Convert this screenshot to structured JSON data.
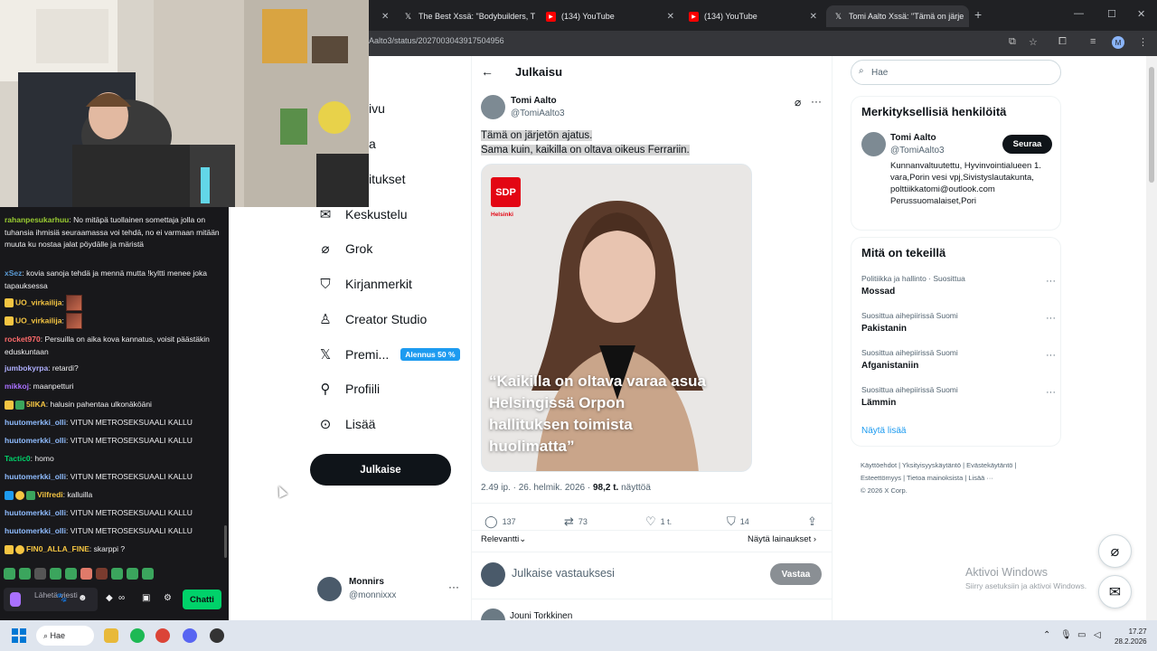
{
  "browser": {
    "tabs": [
      {
        "label": "",
        "favicon": "tab-blank"
      },
      {
        "label": "The Best Xssä: \"Bodybuilders, T",
        "favicon": "x-icon"
      },
      {
        "label": "(134) YouTube",
        "favicon": "youtube-icon"
      },
      {
        "label": "(134) YouTube",
        "favicon": "youtube-icon"
      },
      {
        "label": "Tomi Aalto Xssä: \"Tämä on järje",
        "favicon": "x-icon"
      }
    ],
    "url": "Aalto3/status/2027003043917504956",
    "profile_initial": "M"
  },
  "chat": {
    "messages": [
      {
        "user": "rahanpesukarhuu",
        "color": "#9acd32",
        "text": "No mitäpä tuollainen somettaja jolla on tuhansia ihmisiä seuraamassa voi tehdä, no ei varmaan mitään muuta ku nostaa jalat pöydälle ja märistä"
      },
      {
        "user": "xSez",
        "color": "#5b9bd5",
        "text": "kovia sanoja tehdä ja mennä mutta !kyltti menee joka tapauksessa"
      },
      {
        "user": "UO_virkailija",
        "color": "#f5c542",
        "text": ""
      },
      {
        "user": "UO_virkailija",
        "color": "#f5c542",
        "text": ""
      },
      {
        "user": "rocket970",
        "color": "#ff6b6b",
        "text": "Persuilla on aika kova kannatus, voisit päästäkin eduskuntaan"
      },
      {
        "user": "jumbokyrpa",
        "color": "#b0b0ff",
        "text": "retardi?"
      },
      {
        "user": "mikkoj",
        "color": "#a970ff",
        "text": "maanpetturi"
      },
      {
        "user": "5IIKA",
        "color": "#f5c542",
        "text": "halusin pahentaa ulkonäköäni"
      },
      {
        "user": "huutomerkki_olli",
        "color": "#8fbcff",
        "text": "VITUN METROSEKSUAALI KALLU"
      },
      {
        "user": "huutomerkki_olli",
        "color": "#8fbcff",
        "text": "VITUN METROSEKSUAALI KALLU"
      },
      {
        "user": "Tactic0",
        "color": "#00d26a",
        "text": "homo"
      },
      {
        "user": "huutomerkki_olli",
        "color": "#8fbcff",
        "text": "VITUN METROSEKSUAALI KALLU"
      },
      {
        "user": "Vilfredi",
        "color": "#f5c542",
        "text": "kalluilla"
      },
      {
        "user": "huutomerkki_olli",
        "color": "#8fbcff",
        "text": "VITUN METROSEKSUAALI KALLU"
      },
      {
        "user": "huutomerkki_olli",
        "color": "#8fbcff",
        "text": "VITUN METROSEKSUAALI KALLU"
      },
      {
        "user": "FIN0_ALLA_FINE",
        "color": "#f5c542",
        "text": "skarppi ?"
      }
    ],
    "input_placeholder": "Lähetä viesti",
    "send_label": "Chatti"
  },
  "nav": {
    "items": [
      {
        "label": "ivu",
        "icon": "home-icon"
      },
      {
        "label": "a",
        "icon": "search-icon"
      },
      {
        "label": "itukset",
        "icon": "bell-icon"
      },
      {
        "label": "Keskustelu",
        "icon": "mail-icon"
      },
      {
        "label": "Grok",
        "icon": "grok-icon"
      },
      {
        "label": "Kirjanmerkit",
        "icon": "bookmark-icon"
      },
      {
        "label": "Creator Studio",
        "icon": "creator-icon"
      },
      {
        "label": "Premi...",
        "icon": "x-logo-icon",
        "badge": "Alennus 50 %"
      },
      {
        "label": "Profiili",
        "icon": "person-icon"
      },
      {
        "label": "Lisää",
        "icon": "more-circle-icon"
      }
    ],
    "post_button": "Julkaise",
    "account": {
      "name": "Monnirs",
      "handle": "@monnixxx"
    }
  },
  "post": {
    "header_title": "Julkaisu",
    "author_name": "Tomi Aalto",
    "author_handle": "@TomiAalto3",
    "text_line1": "Tämä on järjetön ajatus.",
    "text_line2": "Sama kuin, kaikilla on oltava oikeus Ferrariin.",
    "image": {
      "logo": "SDP",
      "city": "Helsinki",
      "quote": "“Kaikilla on oltava varaa asua Helsingissä Orpon hallituksen toimista huolimatta”"
    },
    "time": "2.49 ip. · 26. helmik. 2026 · ",
    "views_value": "98,2 t.",
    "views_suffix": " näyttöä",
    "replies": "137",
    "reposts": "73",
    "likes": "1 t.",
    "bookmarks": "14",
    "sort_label": "Relevantti",
    "quotes_link": "Näytä lainaukset",
    "reply_placeholder": "Julkaise vastauksesi",
    "reply_button": "Vastaa",
    "next_reply_peek": "Jouni Torkkinen"
  },
  "sidebar": {
    "search_placeholder": "Hae",
    "relevant_title": "Merkityksellisiä henkilöitä",
    "relevant_person": {
      "name": "Tomi Aalto",
      "handle": "@TomiAalto3",
      "follow": "Seuraa",
      "bio": "Kunnanvaltuutettu, Hyvinvointialueen 1. vara,Porin vesi vpj,Sivistyslautakunta, polttiikkatomi@outlook.com Perussuomalaiset,Pori"
    },
    "trends_title": "Mitä on tekeillä",
    "trends": [
      {
        "context": "Politiikka ja hallinto · Suosittua",
        "name": "Mossad"
      },
      {
        "context": "Suosittua aihepiirissä Suomi",
        "name": "Pakistanin"
      },
      {
        "context": "Suosittua aihepiirissä Suomi",
        "name": "Afganistaniin"
      },
      {
        "context": "Suosittua aihepiirissä Suomi",
        "name": "Lämmin"
      }
    ],
    "show_more": "Näytä lisää",
    "footer": {
      "l1": "Käyttöehdot",
      "l2": "Yksityisyyskäytäntö",
      "l3": "Evästekäytäntö",
      "l4": "Esteettömyys",
      "l5": "Tietoa mainoksista",
      "l6": "Lisää ···",
      "copyright": "© 2026 X Corp."
    }
  },
  "watermark": {
    "line1": "Aktivoi Windows",
    "line2": "Siirry asetuksiin ja aktivoi Windows."
  },
  "taskbar": {
    "search": "Hae",
    "time": "17.27",
    "date": "28.2.2026"
  }
}
